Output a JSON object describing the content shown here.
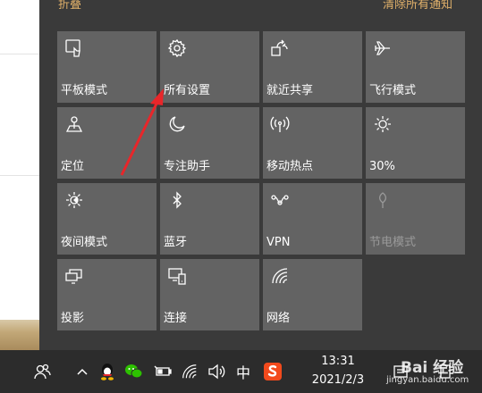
{
  "action_center": {
    "collapse_label": "折叠",
    "clear_all_label": "清除所有通知",
    "tiles": [
      {
        "label": "平板模式",
        "icon": "tablet-mode-icon"
      },
      {
        "label": "所有设置",
        "icon": "gear-icon"
      },
      {
        "label": "就近共享",
        "icon": "nearby-share-icon"
      },
      {
        "label": "飞行模式",
        "icon": "airplane-icon"
      },
      {
        "label": "定位",
        "icon": "location-icon"
      },
      {
        "label": "专注助手",
        "icon": "moon-icon"
      },
      {
        "label": "移动热点",
        "icon": "hotspot-icon"
      },
      {
        "label": "30%",
        "icon": "brightness-icon"
      },
      {
        "label": "夜间模式",
        "icon": "night-light-icon"
      },
      {
        "label": "蓝牙",
        "icon": "bluetooth-icon"
      },
      {
        "label": "VPN",
        "icon": "vpn-icon"
      },
      {
        "label": "节电模式",
        "icon": "battery-saver-icon"
      },
      {
        "label": "投影",
        "icon": "project-icon"
      },
      {
        "label": "连接",
        "icon": "connect-icon"
      },
      {
        "label": "网络",
        "icon": "network-icon"
      }
    ]
  },
  "taskbar": {
    "ime_label": "中",
    "time": "13:31",
    "date": "2021/2/3"
  },
  "watermark": {
    "brand": "Bai 经验",
    "url": "jingyan.baidu.com"
  },
  "colors": {
    "accent": "#e0b06a",
    "tile": "#636363",
    "panel": "#3a3a3a",
    "taskbar": "#2c2c2c",
    "arrow": "#e8262a"
  }
}
